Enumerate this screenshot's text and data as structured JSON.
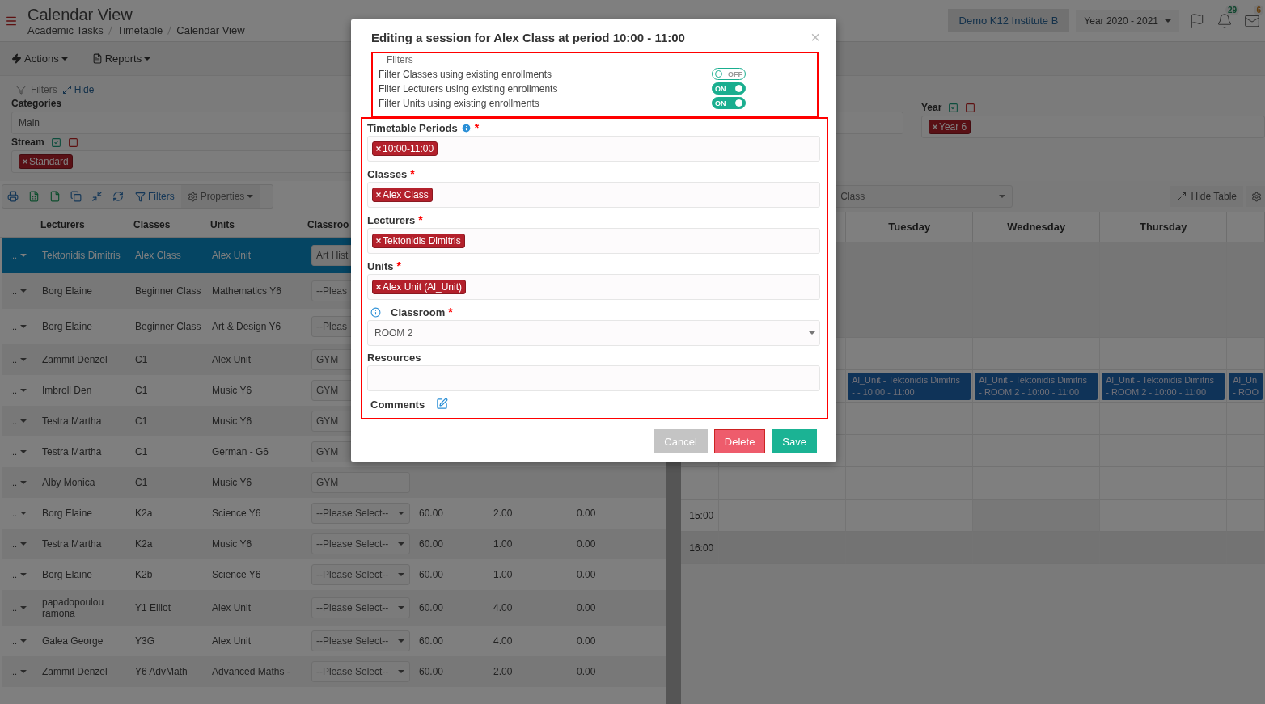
{
  "header": {
    "title": "Calendar View",
    "breadcrumb": [
      "Academic Tasks",
      "Timetable",
      "Calendar View"
    ],
    "institute": "Demo K12 Institute B",
    "year": "Year 2020 - 2021",
    "alerts_count": "29",
    "messages_count": "6"
  },
  "menu": [
    "Actions",
    "Reports"
  ],
  "filters": {
    "legend": "Filters",
    "hide": "Hide",
    "categories": {
      "label": "Categories",
      "value": "Main"
    },
    "stream": {
      "label": "Stream",
      "chips": [
        "Standard"
      ]
    },
    "year": {
      "label": "Year",
      "chips": [
        "Year 6"
      ]
    }
  },
  "table_toolbar": {
    "filters": "Filters",
    "properties": "Properties"
  },
  "table": {
    "columns": [
      "Lecturers",
      "Classes",
      "Units",
      "Classroo"
    ],
    "rows": [
      {
        "menu": "...",
        "selected": true,
        "lecturer": "Tektonidis Dimitris",
        "class": "Alex Class",
        "unit": "Alex Unit",
        "classroom": "Art Hist"
      },
      {
        "menu": "...",
        "selected": false,
        "lecturer": "Borg Elaine",
        "class": "Beginner Class",
        "unit": "Mathematics Y6",
        "classroom": "--Pleas"
      },
      {
        "menu": "...",
        "selected": false,
        "lecturer": "Borg Elaine",
        "class": "Beginner Class",
        "unit": "Art & Design Y6",
        "classroom": "--Pleas"
      },
      {
        "menu": "...",
        "selected": false,
        "lecturer": "Zammit Denzel",
        "class": "C1",
        "unit": "Alex Unit",
        "classroom": "GYM"
      },
      {
        "menu": "...",
        "selected": false,
        "lecturer": "Imbroll Den",
        "class": "C1",
        "unit": "Music Y6",
        "classroom": "GYM"
      },
      {
        "menu": "...",
        "selected": false,
        "lecturer": "Testra Martha",
        "class": "C1",
        "unit": "Music Y6",
        "classroom": "GYM"
      },
      {
        "menu": "...",
        "selected": false,
        "lecturer": "Testra Martha",
        "class": "C1",
        "unit": "German - G6",
        "classroom": "GYM"
      },
      {
        "menu": "...",
        "selected": false,
        "lecturer": "Alby Monica",
        "class": "C1",
        "unit": "Music Y6",
        "classroom": "GYM"
      },
      {
        "menu": "...",
        "selected": false,
        "lecturer": "Borg Elaine",
        "class": "K2a",
        "unit": "Science Y6",
        "classroom": "--Please Select--",
        "column_5": "60.00",
        "column_6": "2.00",
        "column_7": "0.00"
      },
      {
        "menu": "...",
        "selected": false,
        "lecturer": "Testra Martha",
        "class": "K2a",
        "unit": "Music Y6",
        "classroom": "--Please Select--",
        "column_5": "60.00",
        "column_6": "1.00",
        "column_7": "0.00"
      },
      {
        "menu": "...",
        "selected": false,
        "lecturer": "Borg Elaine",
        "class": "K2b",
        "unit": "Science Y6",
        "classroom": "--Please Select--",
        "column_5": "60.00",
        "column_6": "1.00",
        "column_7": "0.00"
      },
      {
        "menu": "...",
        "selected": false,
        "lecturer": "papadopoulou ramona",
        "class": "Y1 Elliot",
        "unit": "Alex Unit",
        "classroom": "--Please Select--",
        "column_5": "60.00",
        "column_6": "4.00",
        "column_7": "0.00"
      },
      {
        "menu": "...",
        "selected": false,
        "lecturer": "Galea George",
        "class": "Y3G",
        "unit": "Alex Unit",
        "classroom": "--Please Select--",
        "column_5": "60.00",
        "column_6": "4.00",
        "column_7": "0.00"
      },
      {
        "menu": "...",
        "selected": false,
        "lecturer": "Zammit Denzel",
        "class": "Y6 AdvMath",
        "unit": "Advanced Maths -",
        "classroom": "--Please Select--",
        "column_5": "60.00",
        "column_6": "2.00",
        "column_7": "0.00"
      }
    ]
  },
  "calendar": {
    "class_select": "Class",
    "hide_table": "Hide Table",
    "days": [
      "Tuesday",
      "Wednesday",
      "Thursday"
    ],
    "events": [
      {
        "lines": [
          "Al_Unit - Tektonidis Dimitris",
          "- - 10:00 - 11:00"
        ]
      },
      {
        "lines": [
          "Al_Unit - Tektonidis Dimitris",
          "- ROOM 2 - 10:00 - 11:00"
        ]
      },
      {
        "lines": [
          "Al_Unit - Tektonidis Dimitris",
          "- ROOM 2 - 10:00 - 11:00"
        ]
      },
      {
        "lines": [
          "Al_Un",
          "- ROO"
        ]
      }
    ],
    "times": [
      "15:00",
      "16:00"
    ]
  },
  "modal": {
    "title": "Editing a session for Alex Class at period 10:00 - 11:00",
    "close": "×",
    "filters_legend": "Filters",
    "toggles": [
      {
        "label": "Filter Classes using existing enrollments",
        "on": false,
        "state_label": "OFF"
      },
      {
        "label": "Filter Lecturers using existing enrollments",
        "on": true,
        "state_label": "ON"
      },
      {
        "label": "Filter Units using existing enrollments",
        "on": true,
        "state_label": "ON"
      }
    ],
    "fields": [
      {
        "kind": "chips",
        "label": "Timetable Periods",
        "info": true,
        "required_mark": "*",
        "chips": [
          "10:00-11:00"
        ]
      },
      {
        "kind": "chips",
        "label": "Classes",
        "required_mark": "*",
        "chips": [
          "Alex Class"
        ]
      },
      {
        "kind": "chips",
        "label": "Lecturers",
        "required_mark": "*",
        "chips": [
          "Tektonidis Dimitris"
        ]
      },
      {
        "kind": "chips",
        "label": "Units",
        "required_mark": "*",
        "chips": [
          "Alex Unit (Al_Unit)"
        ]
      },
      {
        "kind": "select",
        "label": "Classroom",
        "info": true,
        "required_mark": "*",
        "value": "ROOM 2"
      },
      {
        "kind": "input",
        "label": "Resources"
      },
      {
        "kind": "comments",
        "label": "Comments"
      }
    ],
    "buttons": [
      {
        "kind": "cancel",
        "label": "Cancel"
      },
      {
        "kind": "delete",
        "label": "Delete"
      },
      {
        "kind": "save",
        "label": "Save"
      }
    ]
  }
}
